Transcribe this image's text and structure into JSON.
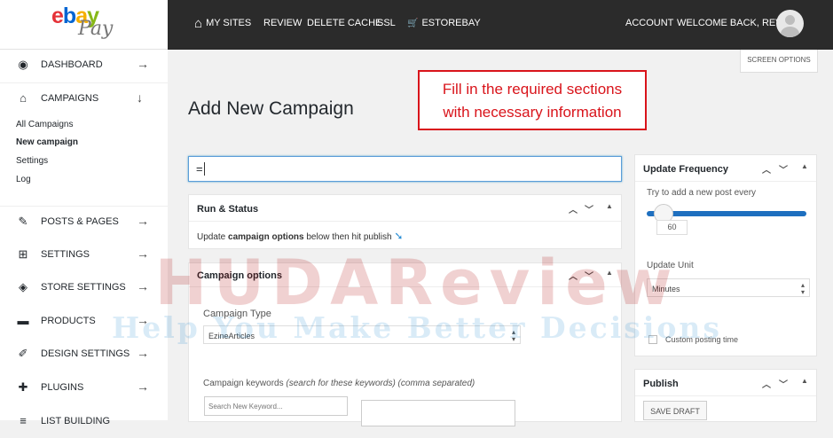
{
  "brand": {
    "logo_ebay": "ebay",
    "logo_pay": "Pay"
  },
  "topnav": {
    "my_sites": "MY SITES",
    "review": "REVIEW",
    "delete_cache": "DELETE CACHE",
    "ssl": "SSL",
    "estorebay": "ESTOREBAY",
    "account": "ACCOUNT",
    "welcome": "WELCOME BACK, REVIEW"
  },
  "sidebar": {
    "items": [
      {
        "label": "DASHBOARD",
        "icon": "dashboard-icon",
        "arrow": "→"
      },
      {
        "label": "CAMPAIGNS",
        "icon": "store-icon",
        "arrow": "↓"
      },
      {
        "label": "POSTS & PAGES",
        "icon": "pin-icon",
        "arrow": "→"
      },
      {
        "label": "SETTINGS",
        "icon": "plus-square-icon",
        "arrow": "→"
      },
      {
        "label": "STORE SETTINGS",
        "icon": "tag-icon",
        "arrow": "→"
      },
      {
        "label": "PRODUCTS",
        "icon": "box-icon",
        "arrow": "→"
      },
      {
        "label": "DESIGN SETTINGS",
        "icon": "brush-icon",
        "arrow": "→"
      },
      {
        "label": "PLUGINS",
        "icon": "plug-icon",
        "arrow": "→"
      },
      {
        "label": "LIST BUILDING",
        "icon": "list-icon",
        "arrow": ""
      }
    ],
    "subitems": [
      "All Campaigns",
      "New campaign",
      "Settings",
      "Log"
    ]
  },
  "screen_options": "SCREEN OPTIONS",
  "page_title": "Add New Campaign",
  "callout": {
    "line1": "Fill in the required sections",
    "line2": "with necessary information"
  },
  "title_input": {
    "value": "="
  },
  "run_status": {
    "title": "Run & Status",
    "text_before": "Update ",
    "text_bold": "campaign options",
    "text_after": " below then hit publish"
  },
  "campaign_options": {
    "title": "Campaign options",
    "type_label": "Campaign Type",
    "type_value": "EzineArticles",
    "keywords_label": "Campaign keywords",
    "keywords_hint": "(search for these keywords) (comma separated)",
    "search_placeholder": "Search New Keyword..."
  },
  "update_frequency": {
    "title": "Update Frequency",
    "hint": "Try to add a new post every",
    "value": "60",
    "unit_label": "Update Unit",
    "unit_value": "Minutes",
    "custom_time": "Custom posting time"
  },
  "publish": {
    "title": "Publish",
    "save_draft": "SAVE DRAFT"
  },
  "watermark": {
    "line1": "HUDAReview",
    "line2": "Help You Make Better Decisions"
  },
  "colors": {
    "accent": "#1e6fbf",
    "callout": "#d9141b",
    "topbar": "#2b2b2b"
  }
}
